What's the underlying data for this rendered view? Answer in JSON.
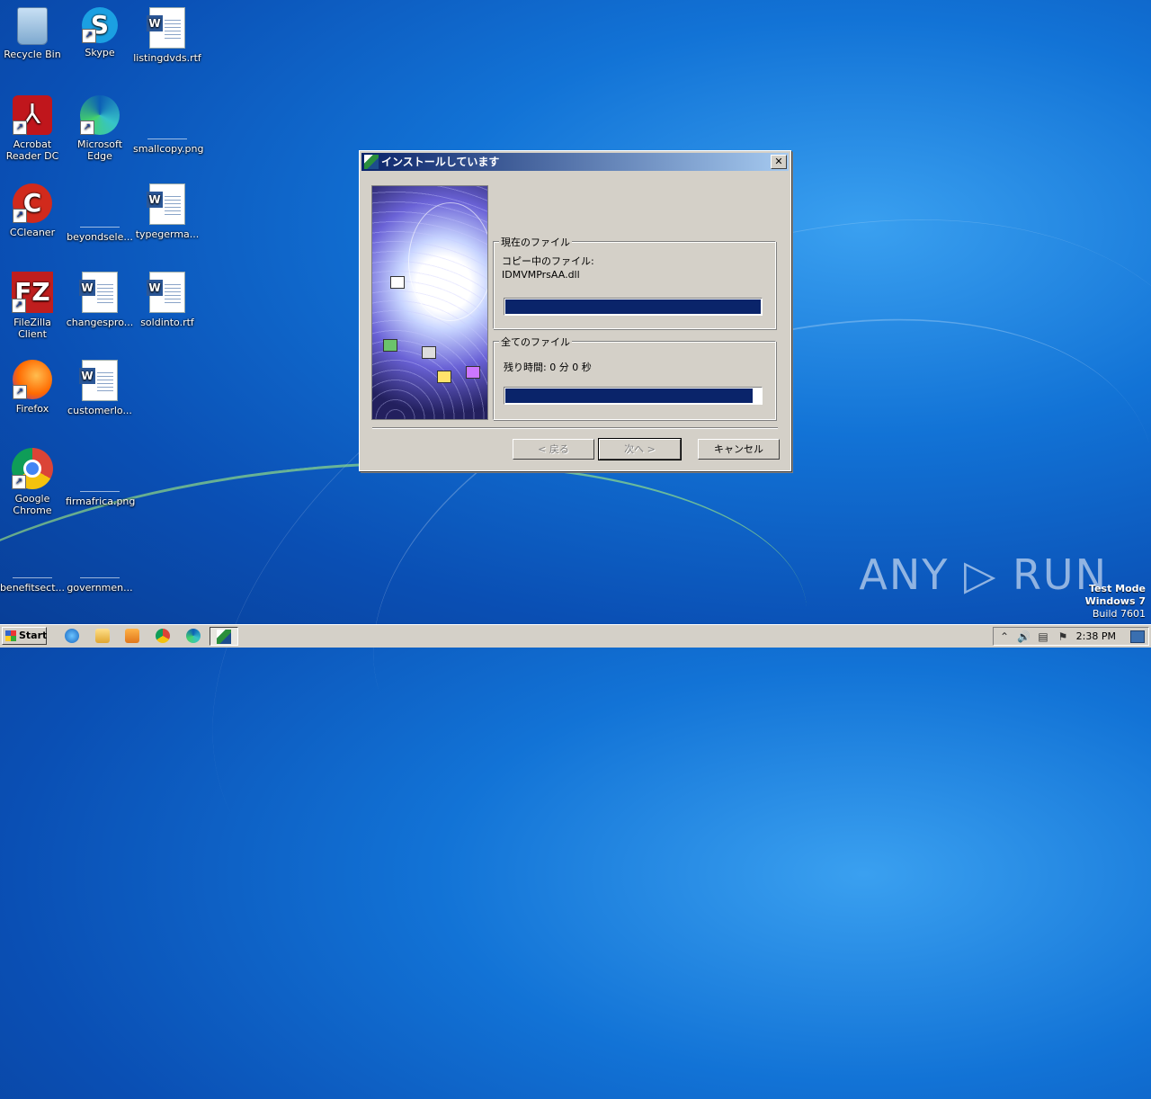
{
  "desktop": {
    "icons": [
      {
        "label": "Recycle Bin",
        "icon": "recycle-bin-icon"
      },
      {
        "label": "Skype",
        "icon": "skype-icon"
      },
      {
        "label": "listingdvds.rtf",
        "icon": "word-document-icon"
      },
      {
        "label": "Acrobat Reader DC",
        "icon": "acrobat-icon"
      },
      {
        "label": "Microsoft Edge",
        "icon": "edge-icon"
      },
      {
        "label": "smallcopy.png",
        "icon": "image-file-icon"
      },
      {
        "label": "CCleaner",
        "icon": "ccleaner-icon"
      },
      {
        "label": "beyondsele...",
        "icon": "image-file-icon"
      },
      {
        "label": "typegerma...",
        "icon": "word-document-icon"
      },
      {
        "label": "FileZilla Client",
        "icon": "filezilla-icon"
      },
      {
        "label": "changespro...",
        "icon": "word-document-icon"
      },
      {
        "label": "soldinto.rtf",
        "icon": "word-document-icon"
      },
      {
        "label": "Firefox",
        "icon": "firefox-icon"
      },
      {
        "label": "customerlo...",
        "icon": "word-document-icon"
      },
      {
        "label": "Google Chrome",
        "icon": "chrome-icon"
      },
      {
        "label": "firmafrica.png",
        "icon": "image-file-icon"
      },
      {
        "label": "benefitsect...",
        "icon": "image-file-icon"
      },
      {
        "label": "governmen...",
        "icon": "image-file-icon"
      }
    ]
  },
  "dialog": {
    "title": "インストールしています",
    "close_glyph": "✕",
    "current_file": {
      "group_title": "現在のファイル",
      "copying_label": "コピー中のファイル:",
      "filename": "IDMVMPrsAA.dll",
      "progress": 1.0
    },
    "all_files": {
      "group_title": "全てのファイル",
      "time_remaining": "残り時間: 0 分 0 秒",
      "progress": 0.97
    },
    "buttons": {
      "back": "< 戻る",
      "next": "次へ >",
      "cancel": "キャンセル"
    }
  },
  "taskbar": {
    "start_label": "Start",
    "clock": "2:38 PM",
    "quick_launch": [
      "internet-explorer-icon",
      "explorer-folder-icon",
      "media-player-icon",
      "chrome-icon",
      "edge-icon"
    ],
    "tray": {
      "arrow": "⌃",
      "speaker": "🔊",
      "network": "▤",
      "flag": "⚑"
    }
  },
  "watermark": {
    "text": "ANY ▷ RUN"
  },
  "test_mode": {
    "line1": "Test Mode",
    "line2": "Windows 7",
    "line3": "Build 7601"
  }
}
